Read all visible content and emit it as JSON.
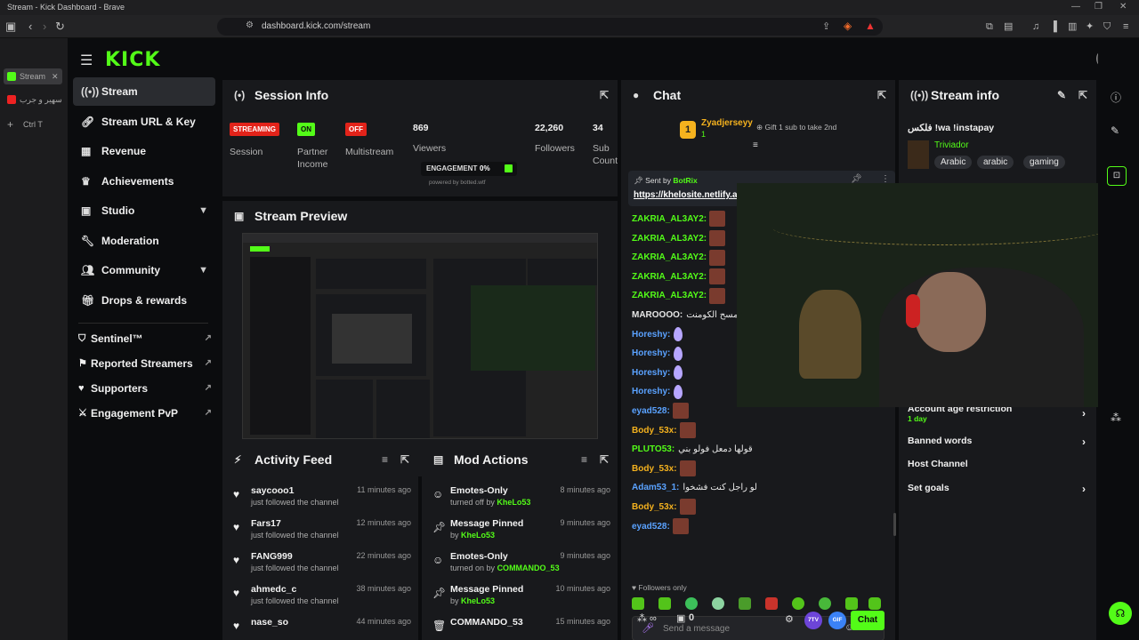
{
  "window": {
    "title": "Stream - Kick Dashboard - Brave"
  },
  "browser": {
    "url": "dashboard.kick.com/stream",
    "tabs": [
      {
        "label": "Stream"
      },
      {
        "label": "سهير و جرب"
      }
    ],
    "tab_shortcut": "Ctrl T"
  },
  "brand": {
    "name": "KICK",
    "accent": "#53fc18"
  },
  "sidebar": {
    "items": [
      {
        "label": "Stream",
        "icon": "broadcast-icon"
      },
      {
        "label": "Stream URL & Key",
        "icon": "link-icon"
      },
      {
        "label": "Revenue",
        "icon": "chart-icon"
      },
      {
        "label": "Achievements",
        "icon": "trophy-icon"
      },
      {
        "label": "Studio",
        "icon": "studio-icon"
      },
      {
        "label": "Moderation",
        "icon": "wrench-icon"
      },
      {
        "label": "Community",
        "icon": "people-icon"
      },
      {
        "label": "Drops & rewards",
        "icon": "gift-icon"
      }
    ],
    "external": [
      {
        "label": "Sentinel™"
      },
      {
        "label": "Reported Streamers"
      },
      {
        "label": "Supporters"
      },
      {
        "label": "Engagement PvP"
      }
    ]
  },
  "session_info": {
    "title": "Session Info",
    "stats": {
      "streaming_badge": "STREAMING",
      "session_label": "Session",
      "partner_badge": "ON",
      "partner_label": "Partner Income",
      "multistream_badge": "OFF",
      "multistream_label": "Multistream",
      "viewers": "869",
      "viewers_label": "Viewers",
      "followers": "22,260",
      "followers_label": "Followers",
      "subs": "34",
      "subs_label": "Sub Counts",
      "engagement_label": "ENGAGEMENT",
      "engagement_value": "0%",
      "powered_by": "powered by botted.wtf"
    }
  },
  "stream_preview": {
    "title": "Stream Preview"
  },
  "activity_feed": {
    "title": "Activity Feed",
    "items": [
      {
        "name": "saycooo1",
        "desc": "just followed the channel",
        "time": "11 minutes ago"
      },
      {
        "name": "Fars17",
        "desc": "just followed the channel",
        "time": "12 minutes ago"
      },
      {
        "name": "FANG999",
        "desc": "just followed the channel",
        "time": "22 minutes ago"
      },
      {
        "name": "ahmedc_c",
        "desc": "just followed the channel",
        "time": "38 minutes ago"
      },
      {
        "name": "nase_so",
        "desc": "",
        "time": "44 minutes ago"
      }
    ]
  },
  "mod_actions": {
    "title": "Mod Actions",
    "items": [
      {
        "action": "Emotes-Only",
        "prefix": "turned off by",
        "by": "KheLo53",
        "time": "8 minutes ago",
        "icon": "emoji-icon"
      },
      {
        "action": "Message Pinned",
        "prefix": "by",
        "by": "KheLo53",
        "time": "9 minutes ago",
        "icon": "pin-icon"
      },
      {
        "action": "Emotes-Only",
        "prefix": "turned on by",
        "by": "COMMANDO_53",
        "time": "9 minutes ago",
        "icon": "emoji-icon"
      },
      {
        "action": "Message Pinned",
        "prefix": "by",
        "by": "KheLo53",
        "time": "10 minutes ago",
        "icon": "pin-icon"
      },
      {
        "action": "COMMANDO_53",
        "prefix": "",
        "by": "",
        "time": "15 minutes ago",
        "icon": "trash-icon"
      }
    ]
  },
  "chat": {
    "title": "Chat",
    "gifter": {
      "name": "Zyadjerseyy",
      "count": "1",
      "gift_text": "Gift 1 sub to take 2nd"
    },
    "pinned": {
      "sent_by": "Sent by",
      "author": "BotRix",
      "link": "https://khelosite.netlify.app"
    },
    "messages": [
      {
        "user": "ZAKRIA_AL3AY2:",
        "color": "#53fc18",
        "text": "",
        "kind": "emote"
      },
      {
        "user": "ZAKRIA_AL3AY2:",
        "color": "#53fc18",
        "text": "",
        "kind": "emote"
      },
      {
        "user": "ZAKRIA_AL3AY2:",
        "color": "#53fc18",
        "text": "",
        "kind": "emote"
      },
      {
        "user": "ZAKRIA_AL3AY2:",
        "color": "#53fc18",
        "text": "",
        "kind": "emote"
      },
      {
        "user": "ZAKRIA_AL3AY2:",
        "color": "#53fc18",
        "text": "",
        "kind": "emote"
      },
      {
        "user": "MAROOOO:",
        "color": "#e6e6e6",
        "text": "مين مسح الكومنت",
        "kind": "text"
      },
      {
        "user": "Horeshy:",
        "color": "#5aa2ff",
        "text": "",
        "kind": "drop"
      },
      {
        "user": "Horeshy:",
        "color": "#5aa2ff",
        "text": "",
        "kind": "drop"
      },
      {
        "user": "Horeshy:",
        "color": "#5aa2ff",
        "text": "",
        "kind": "drop"
      },
      {
        "user": "Horeshy:",
        "color": "#5aa2ff",
        "text": "",
        "kind": "drop"
      },
      {
        "user": "eyad528:",
        "color": "#5aa2ff",
        "text": "",
        "kind": "emote"
      },
      {
        "user": "Body_53x:",
        "color": "#f5b21e",
        "text": "",
        "kind": "emote"
      },
      {
        "user": "PLUTO53:",
        "color": "#53fc18",
        "text": "قولها دمعل فولو بني",
        "kind": "text"
      },
      {
        "user": "Body_53x:",
        "color": "#f5b21e",
        "text": "",
        "kind": "emote"
      },
      {
        "user": "Adam53_1:",
        "color": "#5aa2ff",
        "text": "لو راجل كنت فشخوا",
        "kind": "text"
      },
      {
        "user": "Body_53x:",
        "color": "#f5b21e",
        "text": "",
        "kind": "emote"
      },
      {
        "user": "eyad528:",
        "color": "#5aa2ff",
        "text": "",
        "kind": "emote"
      }
    ],
    "followers_only": "Followers only",
    "placeholder": "Send a message",
    "count": "0",
    "send_label": "Chat",
    "badge_7tv": "7TV",
    "badge_gif": "GIF"
  },
  "stream_info": {
    "title": "Stream info",
    "stream_title": "فلكس !wa !instapay",
    "category": "Triviador",
    "tags": [
      "Arabic",
      "arabic",
      "gaming"
    ],
    "settings": [
      {
        "label": "Account age restriction",
        "value": "1 day",
        "chevron": true
      },
      {
        "label": "Banned words",
        "value": "",
        "chevron": true
      },
      {
        "label": "Host Channel",
        "value": "",
        "chevron": false
      },
      {
        "label": "Set goals",
        "value": "",
        "chevron": true
      }
    ]
  }
}
